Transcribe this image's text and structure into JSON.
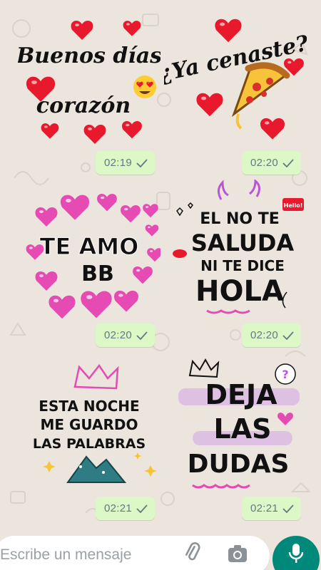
{
  "messages": [
    {
      "sticker": "buenos-dias-corazon",
      "lines": [
        "Buenos días",
        "corazón"
      ],
      "time": "02:19"
    },
    {
      "sticker": "ya-cenaste",
      "lines": [
        "¿Ya cenaste?"
      ],
      "time": "02:20"
    },
    {
      "sticker": "te-amo-bb",
      "lines": [
        "TE AMO",
        "BB"
      ],
      "time": "02:20"
    },
    {
      "sticker": "el-no-te-saluda",
      "lines": [
        "EL NO TE",
        "SALUDA",
        "NI TE DICE",
        "HOLA"
      ],
      "badge": "Hello!",
      "time": "02:20"
    },
    {
      "sticker": "esta-noche",
      "lines": [
        "ESTA NOCHE",
        "ME GUARDO",
        "LAS PALABRAS"
      ],
      "time": "02:21"
    },
    {
      "sticker": "deja-las-dudas",
      "lines": [
        "DEJA",
        "LAS",
        "DUDAS"
      ],
      "badge": "?",
      "time": "02:21"
    }
  ],
  "composer": {
    "placeholder": "Escribe un mensaje"
  },
  "icons": {
    "attach": "paperclip-icon",
    "camera": "camera-icon",
    "mic": "microphone-icon",
    "read_receipt": "check-icon"
  },
  "colors": {
    "background": "#ece5dd",
    "bubble": "#dcf8c6",
    "mic_button": "#00897b",
    "heart": "#e8192c",
    "pink": "#e54bb3"
  }
}
